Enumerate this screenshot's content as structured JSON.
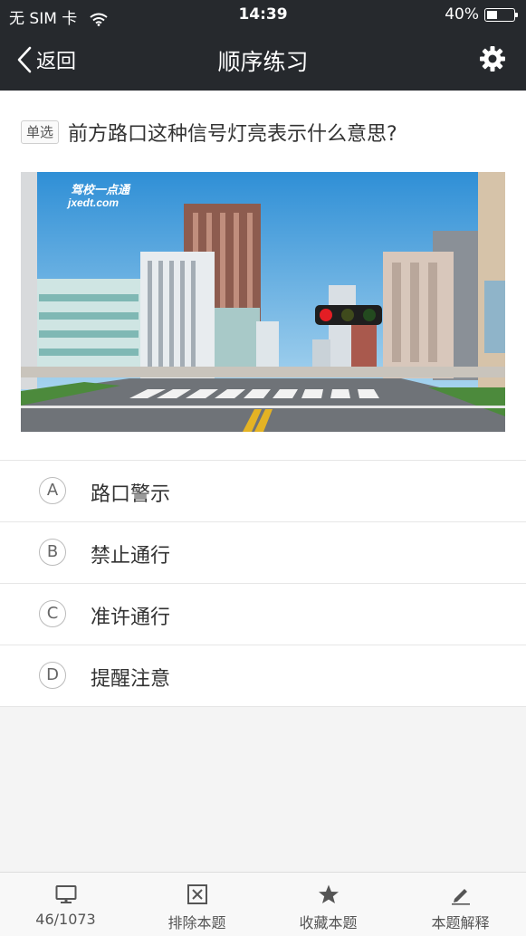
{
  "status": {
    "carrier": "无 SIM 卡",
    "time": "14:39",
    "battery": "40%",
    "battery_level": 0.4
  },
  "nav": {
    "back_label": "返回",
    "title": "顺序练习"
  },
  "question": {
    "type_tag": "单选",
    "text": "前方路口这种信号灯亮表示什么意思?"
  },
  "image": {
    "watermark_cn": "驾校一点通",
    "watermark_en": "jxedt.com"
  },
  "options": [
    {
      "letter": "A",
      "text": "路口警示"
    },
    {
      "letter": "B",
      "text": "禁止通行"
    },
    {
      "letter": "C",
      "text": "准许通行"
    },
    {
      "letter": "D",
      "text": "提醒注意"
    }
  ],
  "toolbar": {
    "progress": "46/1073",
    "exclude": "排除本题",
    "favorite": "收藏本题",
    "explain": "本题解释"
  },
  "colors": {
    "bar_bg": "#26292d",
    "signal_red": "#e31e24"
  }
}
